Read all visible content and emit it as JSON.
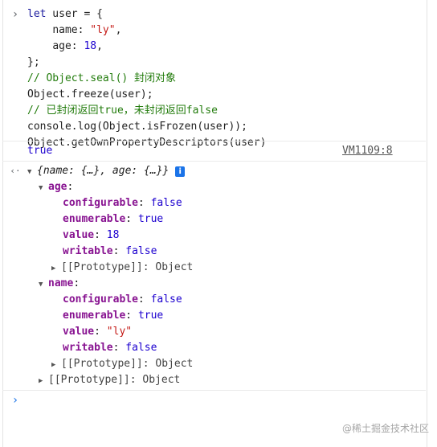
{
  "input": {
    "l1": {
      "kw": "let",
      "rest": " user = {"
    },
    "l2": {
      "indent": "    ",
      "key": "name",
      "sep": ": ",
      "val": "\"ly\"",
      "end": ","
    },
    "l3": {
      "indent": "    ",
      "key": "age",
      "sep": ": ",
      "val": "18",
      "end": ","
    },
    "l4": "};",
    "l5": "// Object.seal() 封闭对象",
    "l6": "Object.freeze(user);",
    "l7": "// 已封闭返回true，未封闭返回false",
    "l8": "console.log(Object.isFrozen(user));",
    "l9": "Object.getOwnPropertyDescriptors(user)"
  },
  "log": {
    "value": "true",
    "source": "VM1109:8"
  },
  "result": {
    "summary": "{name: {…}, age: {…}}",
    "info": "i",
    "age": {
      "label": "age",
      "configurable": {
        "k": "configurable",
        "v": "false"
      },
      "enumerable": {
        "k": "enumerable",
        "v": "true"
      },
      "value": {
        "k": "value",
        "v": "18"
      },
      "writable": {
        "k": "writable",
        "v": "false"
      },
      "proto": "[[Prototype]]: Object"
    },
    "name": {
      "label": "name",
      "configurable": {
        "k": "configurable",
        "v": "false"
      },
      "enumerable": {
        "k": "enumerable",
        "v": "true"
      },
      "value": {
        "k": "value",
        "v": "\"ly\""
      },
      "writable": {
        "k": "writable",
        "v": "false"
      },
      "proto": "[[Prototype]]: Object"
    },
    "proto": "[[Prototype]]: Object"
  },
  "icons": {
    "input_prompt": "chevron-right-icon",
    "result_arrow": "result-arrow-icon",
    "prompt": "chevron-right-icon"
  },
  "glyphs": {
    "input_prompt": "›",
    "result_arrow": "‹·",
    "prompt": "›",
    "expanded": "▼",
    "collapsed": "▶"
  },
  "watermark": "@稀土掘金技术社区",
  "colors": {
    "keyword": "#1b1b9e",
    "string": "#c41a16",
    "number": "#1c00cf",
    "comment": "#237c0d",
    "property": "#881391",
    "prompt": "#1a73e8"
  }
}
